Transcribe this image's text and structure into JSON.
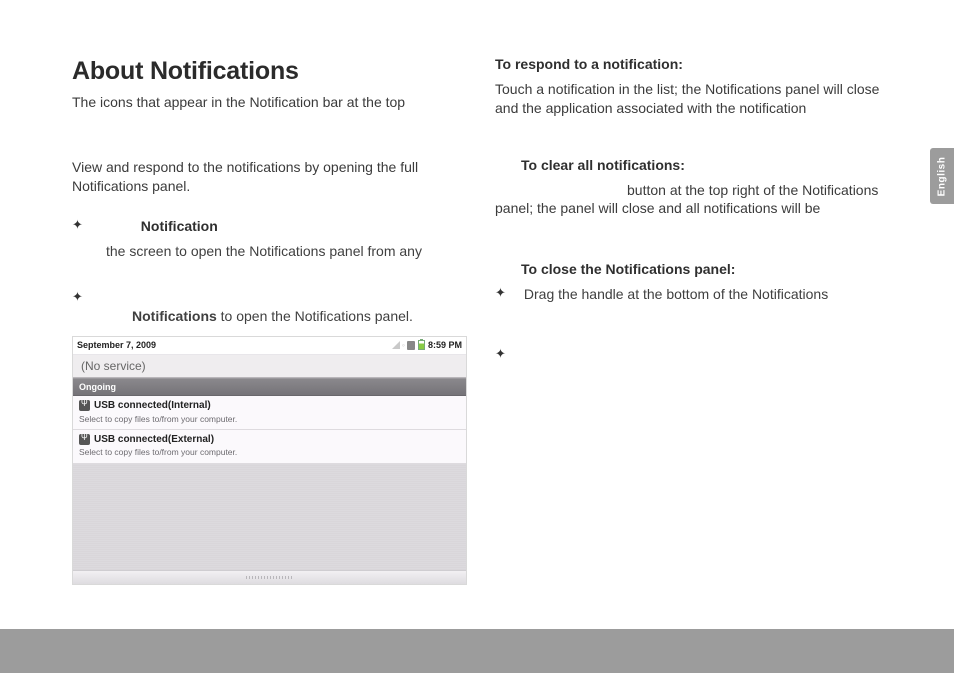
{
  "left": {
    "title": "About Notifications",
    "intro": "The icons that appear in the Notification bar at the top",
    "view_respond": "View and respond to the notifications by opening the full Notifications panel.",
    "bullet1": {
      "word": "Notification"
    },
    "bullet1_body": "the screen to open the Notifications panel from any",
    "bullet2_prefix": "Notifications",
    "bullet2_rest": " to open the Notifications panel."
  },
  "shot": {
    "date": "September 7, 2009",
    "time": "8:59 PM",
    "no_service": "(No service)",
    "ongoing": "Ongoing",
    "items": [
      {
        "title": "USB connected(Internal)",
        "sub": "Select to copy files to/from your computer."
      },
      {
        "title": "USB connected(External)",
        "sub": "Select to copy files to/from your computer."
      }
    ]
  },
  "right": {
    "head1": "To respond to a notification:",
    "body1": "Touch a notification in the list; the Notifications panel will close and the application associated with the notification",
    "head2": "To clear all notifications:",
    "body2": "button at the top right of the Notifications panel; the panel will close and all notifications will be",
    "head3": "To close the Notifications panel:",
    "bullet": "Drag the handle at the bottom of the Notifications"
  },
  "lang": "English"
}
